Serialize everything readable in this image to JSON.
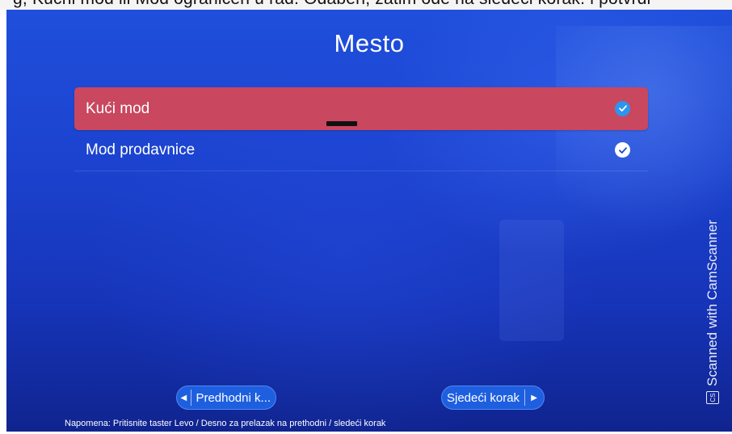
{
  "top_strip": {
    "text": "g, Kućni mod ili Mod ograničen u rad. Odaberi, zatim ode na sledeći korak. i potvrdi"
  },
  "screen": {
    "title": "Mesto"
  },
  "options": [
    {
      "label": "Kući mod",
      "selected": true
    },
    {
      "label": "Mod prodavnice",
      "selected": false
    }
  ],
  "buttons": {
    "prev_label": "Predhodni k...",
    "next_label": "Sjedeći korak"
  },
  "note": "Napomena: Pritisnite taster Levo / Desno za prelazak na prethodni / sledeći korak",
  "watermark": {
    "text": "Scanned with CamScanner",
    "logo": "CS"
  },
  "icons": {
    "check": "check-circle-icon",
    "arrow_left": "arrow-left-icon",
    "arrow_right": "arrow-right-icon"
  },
  "colors": {
    "background": "#1c43cf",
    "selected_row": "#c9475f",
    "check_selected": "#2d95ee",
    "button": "#1e5fe0"
  }
}
